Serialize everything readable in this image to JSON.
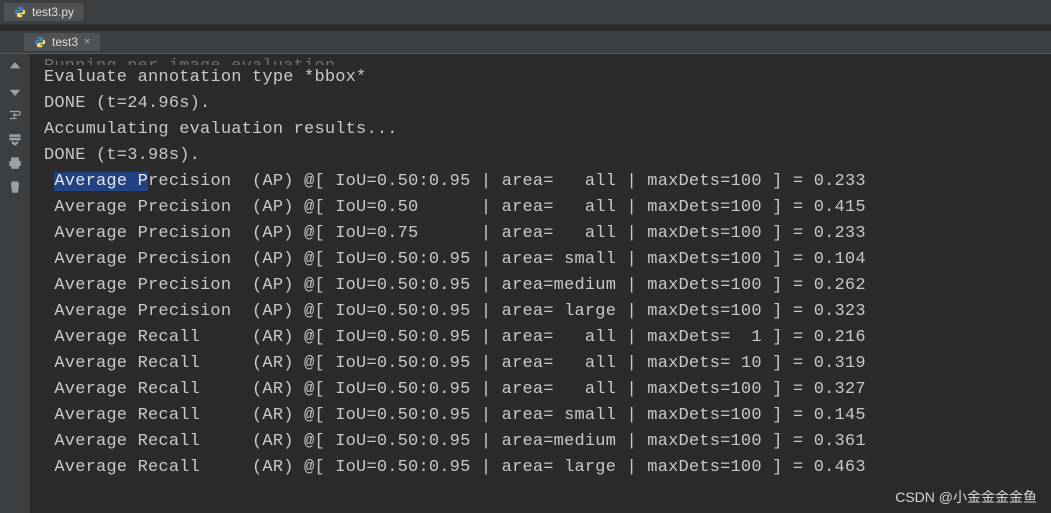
{
  "editor_tab": {
    "filename": "test3.py"
  },
  "run_tab": {
    "name": "test3"
  },
  "console": {
    "cut_line": "Running per image evaluation...",
    "pre_lines": [
      "Evaluate annotation type *bbox*",
      "DONE (t=24.96s).",
      "Accumulating evaluation results...",
      "DONE (t=3.98s)."
    ],
    "sel_text": "Average P",
    "sel_rest": "recision  (AP) @[ IoU=0.50:0.95 | area=   all | maxDets=100 ] = 0.233",
    "metric_lines": [
      " Average Precision  (AP) @[ IoU=0.50      | area=   all | maxDets=100 ] = 0.415",
      " Average Precision  (AP) @[ IoU=0.75      | area=   all | maxDets=100 ] = 0.233",
      " Average Precision  (AP) @[ IoU=0.50:0.95 | area= small | maxDets=100 ] = 0.104",
      " Average Precision  (AP) @[ IoU=0.50:0.95 | area=medium | maxDets=100 ] = 0.262",
      " Average Precision  (AP) @[ IoU=0.50:0.95 | area= large | maxDets=100 ] = 0.323",
      " Average Recall     (AR) @[ IoU=0.50:0.95 | area=   all | maxDets=  1 ] = 0.216",
      " Average Recall     (AR) @[ IoU=0.50:0.95 | area=   all | maxDets= 10 ] = 0.319",
      " Average Recall     (AR) @[ IoU=0.50:0.95 | area=   all | maxDets=100 ] = 0.327",
      " Average Recall     (AR) @[ IoU=0.50:0.95 | area= small | maxDets=100 ] = 0.145",
      " Average Recall     (AR) @[ IoU=0.50:0.95 | area=medium | maxDets=100 ] = 0.361",
      " Average Recall     (AR) @[ IoU=0.50:0.95 | area= large | maxDets=100 ] = 0.463"
    ]
  },
  "watermark": "CSDN @小金金金金鱼"
}
